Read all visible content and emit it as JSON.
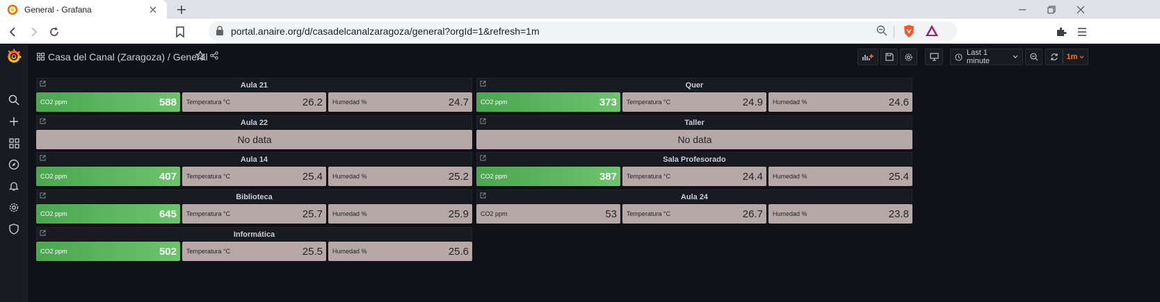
{
  "browser": {
    "tab_title": "General - Grafana",
    "url": "portal.anaire.org/d/casadelcanalzaragoza/general?orgId=1&refresh=1m"
  },
  "dashboard": {
    "title": "Casa del Canal (Zaragoza) / General",
    "time_range": "Last 1 minute",
    "refresh": "1m"
  },
  "panels": {
    "aula21": {
      "title": "Aula 21",
      "co2_label": "CO2 ppm",
      "co2": "588",
      "temp_label": "Temperatura °C",
      "temp": "26.2",
      "hum_label": "Humedad %",
      "hum": "24.7"
    },
    "quer": {
      "title": "Quer",
      "co2_label": "CO2 ppm",
      "co2": "373",
      "temp_label": "Temperatura °C",
      "temp": "24.9",
      "hum_label": "Humedad %",
      "hum": "24.6"
    },
    "aula22": {
      "title": "Aula 22",
      "no_data": "No data"
    },
    "taller": {
      "title": "Taller",
      "no_data": "No data"
    },
    "aula14": {
      "title": "Aula 14",
      "co2_label": "CO2 ppm",
      "co2": "407",
      "temp_label": "Temperatura °C",
      "temp": "25.4",
      "hum_label": "Humedad %",
      "hum": "25.2"
    },
    "salaprof": {
      "title": "Sala Profesorado",
      "co2_label": "CO2 ppm",
      "co2": "387",
      "temp_label": "Temperatura °C",
      "temp": "24.4",
      "hum_label": "Humedad %",
      "hum": "25.4"
    },
    "biblioteca": {
      "title": "Biblioteca",
      "co2_label": "CO2 ppm",
      "co2": "645",
      "temp_label": "Temperatura °C",
      "temp": "25.7",
      "hum_label": "Humedad %",
      "hum": "25.9"
    },
    "aula24": {
      "title": "Aula 24",
      "co2_label": "CO2 ppm",
      "co2": "53",
      "temp_label": "Temperatura °C",
      "temp": "26.7",
      "hum_label": "Humedad %",
      "hum": "23.8"
    },
    "informatica": {
      "title": "Informática",
      "co2_label": "CO2 ppm",
      "co2": "502",
      "temp_label": "Temperatura °C",
      "temp": "25.5",
      "hum_label": "Humedad %",
      "hum": "25.6"
    }
  },
  "colors": {
    "ok_green": "#56a64b",
    "neutral": "#b7a8a8",
    "grafana_orange": "#ff7a1a",
    "background": "#111217"
  }
}
